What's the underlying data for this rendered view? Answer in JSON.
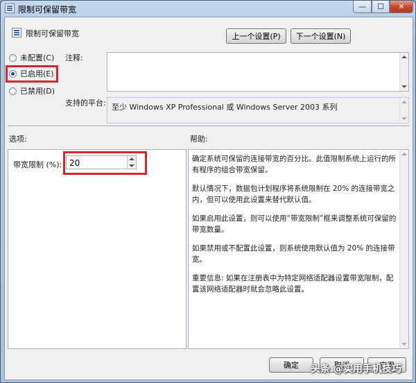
{
  "window": {
    "title": "限制可保留带宽",
    "controls": {
      "minimize": "—",
      "maximize": "☐",
      "close": "✕"
    }
  },
  "header": {
    "title": "限制可保留带宽",
    "prev_button": "上一个设置(P)",
    "next_button": "下一个设置(N)"
  },
  "state": {
    "options": [
      {
        "label": "未配置(C)",
        "checked": false
      },
      {
        "label": "已启用(E)",
        "checked": true
      },
      {
        "label": "已禁用(D)",
        "checked": false
      }
    ]
  },
  "comment": {
    "label": "注释:",
    "value": ""
  },
  "platform": {
    "label": "支持的平台:",
    "value": "至少 Windows XP Professional 或 Windows Server 2003 系列"
  },
  "sections": {
    "options_label": "选项:",
    "help_label": "帮助:"
  },
  "options_panel": {
    "bandwidth_label": "带宽限制 (%):",
    "bandwidth_value": "20"
  },
  "help": {
    "paragraphs": [
      "确定系统可保留的连接带宽的百分比。此值限制系统上运行的所有程序的组合带宽保留。",
      "默认情况下，数据包计划程序将系统限制在 20% 的连接带宽之内，但可以使用此设置来替代默认值。",
      "如果启用此设置，则可以使用“带宽限制”框来调整系统可保留的带宽数量。",
      "如果禁用或不配置此设置，则系统使用默认值为 20% 的连接带宽。",
      "重要信息: 如果在注册表中为特定网络适配器设置带宽限制，配置该网络适配器时就会忽略此设置。"
    ]
  },
  "footer": {
    "ok": "确定",
    "cancel": "取消",
    "apply": "应用"
  },
  "watermark": "头条 @实用手机技巧",
  "colors": {
    "highlight": "#d9232e",
    "titlebar": "#b7cde6",
    "close": "#c6492f"
  }
}
